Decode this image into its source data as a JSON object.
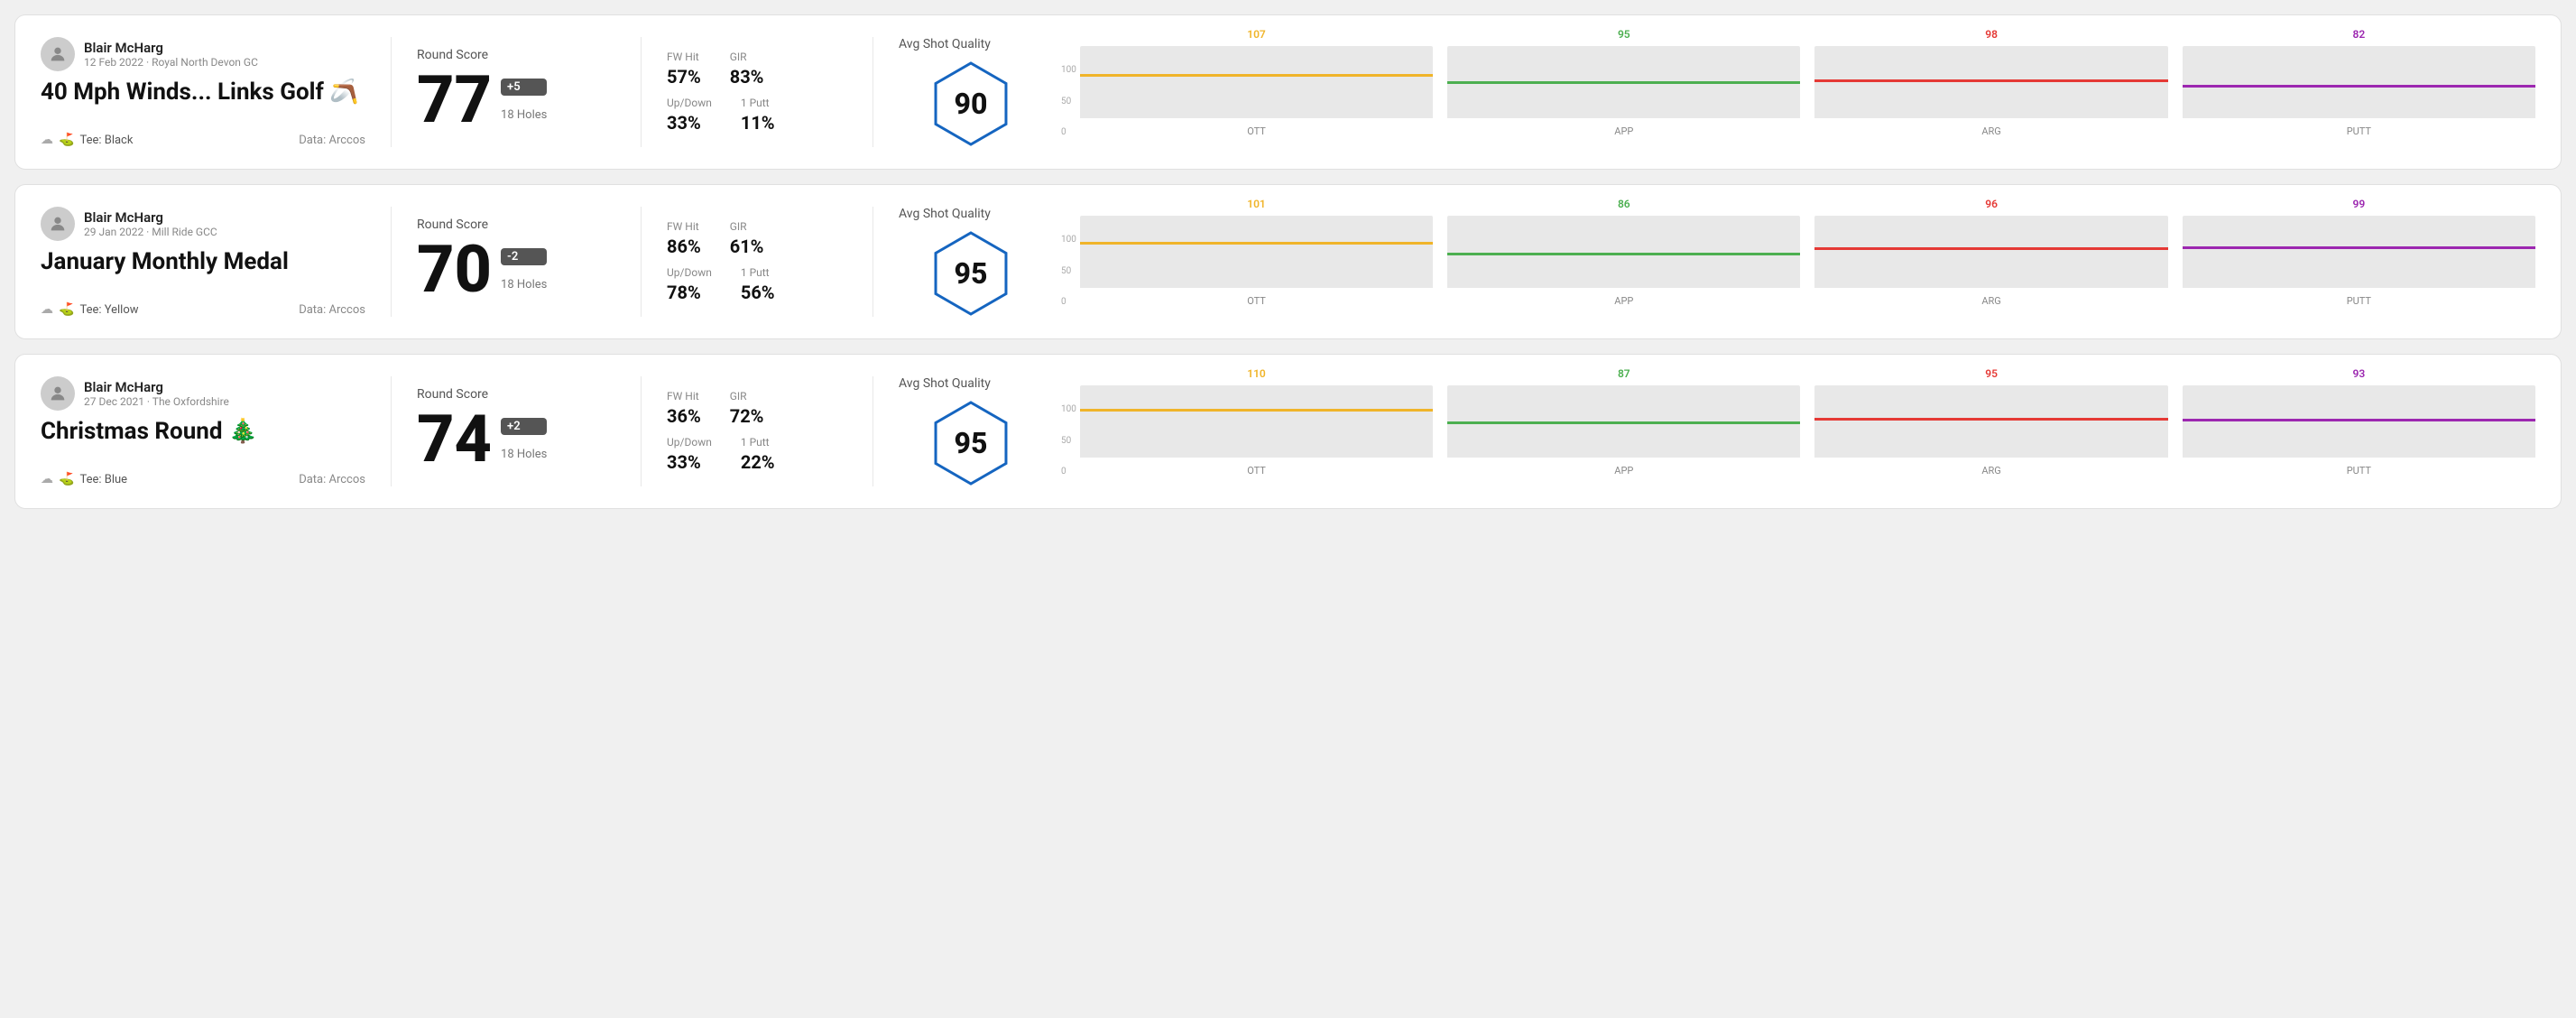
{
  "rounds": [
    {
      "id": "round1",
      "user": {
        "name": "Blair McHarg",
        "date": "12 Feb 2022 · Royal North Devon GC"
      },
      "title": "40 Mph Winds... Links Golf 🪃",
      "tee": "Black",
      "data_source": "Data: Arccos",
      "score": {
        "label": "Round Score",
        "value": "77",
        "modifier": "+5",
        "holes": "18 Holes"
      },
      "stats": {
        "fw_hit_label": "FW Hit",
        "fw_hit_value": "57%",
        "gir_label": "GIR",
        "gir_value": "83%",
        "updown_label": "Up/Down",
        "updown_value": "33%",
        "oneputt_label": "1 Putt",
        "oneputt_value": "11%"
      },
      "quality": {
        "label": "Avg Shot Quality",
        "value": "90"
      },
      "chart": {
        "bars": [
          {
            "label": "OTT",
            "top_value": "107",
            "color": "#f0b429",
            "fill_pct": 72
          },
          {
            "label": "APP",
            "top_value": "95",
            "color": "#4caf50",
            "fill_pct": 60
          },
          {
            "label": "ARG",
            "top_value": "98",
            "color": "#e53935",
            "fill_pct": 63
          },
          {
            "label": "PUTT",
            "top_value": "82",
            "color": "#9c27b0",
            "fill_pct": 52
          }
        ],
        "y_max": "100",
        "y_mid": "50",
        "y_min": "0"
      }
    },
    {
      "id": "round2",
      "user": {
        "name": "Blair McHarg",
        "date": "29 Jan 2022 · Mill Ride GCC"
      },
      "title": "January Monthly Medal",
      "tee": "Yellow",
      "data_source": "Data: Arccos",
      "score": {
        "label": "Round Score",
        "value": "70",
        "modifier": "-2",
        "holes": "18 Holes"
      },
      "stats": {
        "fw_hit_label": "FW Hit",
        "fw_hit_value": "86%",
        "gir_label": "GIR",
        "gir_value": "61%",
        "updown_label": "Up/Down",
        "updown_value": "78%",
        "oneputt_label": "1 Putt",
        "oneputt_value": "56%"
      },
      "quality": {
        "label": "Avg Shot Quality",
        "value": "95"
      },
      "chart": {
        "bars": [
          {
            "label": "OTT",
            "top_value": "101",
            "color": "#f0b429",
            "fill_pct": 75
          },
          {
            "label": "APP",
            "top_value": "86",
            "color": "#4caf50",
            "fill_pct": 56
          },
          {
            "label": "ARG",
            "top_value": "96",
            "color": "#e53935",
            "fill_pct": 65
          },
          {
            "label": "PUTT",
            "top_value": "99",
            "color": "#9c27b0",
            "fill_pct": 68
          }
        ],
        "y_max": "100",
        "y_mid": "50",
        "y_min": "0"
      }
    },
    {
      "id": "round3",
      "user": {
        "name": "Blair McHarg",
        "date": "27 Dec 2021 · The Oxfordshire"
      },
      "title": "Christmas Round 🎄",
      "tee": "Blue",
      "data_source": "Data: Arccos",
      "score": {
        "label": "Round Score",
        "value": "74",
        "modifier": "+2",
        "holes": "18 Holes"
      },
      "stats": {
        "fw_hit_label": "FW Hit",
        "fw_hit_value": "36%",
        "gir_label": "GIR",
        "gir_value": "72%",
        "updown_label": "Up/Down",
        "updown_value": "33%",
        "oneputt_label": "1 Putt",
        "oneputt_value": "22%"
      },
      "quality": {
        "label": "Avg Shot Quality",
        "value": "95"
      },
      "chart": {
        "bars": [
          {
            "label": "OTT",
            "top_value": "110",
            "color": "#f0b429",
            "fill_pct": 80
          },
          {
            "label": "APP",
            "top_value": "87",
            "color": "#4caf50",
            "fill_pct": 57
          },
          {
            "label": "ARG",
            "top_value": "95",
            "color": "#e53935",
            "fill_pct": 64
          },
          {
            "label": "PUTT",
            "top_value": "93",
            "color": "#9c27b0",
            "fill_pct": 62
          }
        ],
        "y_max": "100",
        "y_mid": "50",
        "y_min": "0"
      }
    }
  ]
}
